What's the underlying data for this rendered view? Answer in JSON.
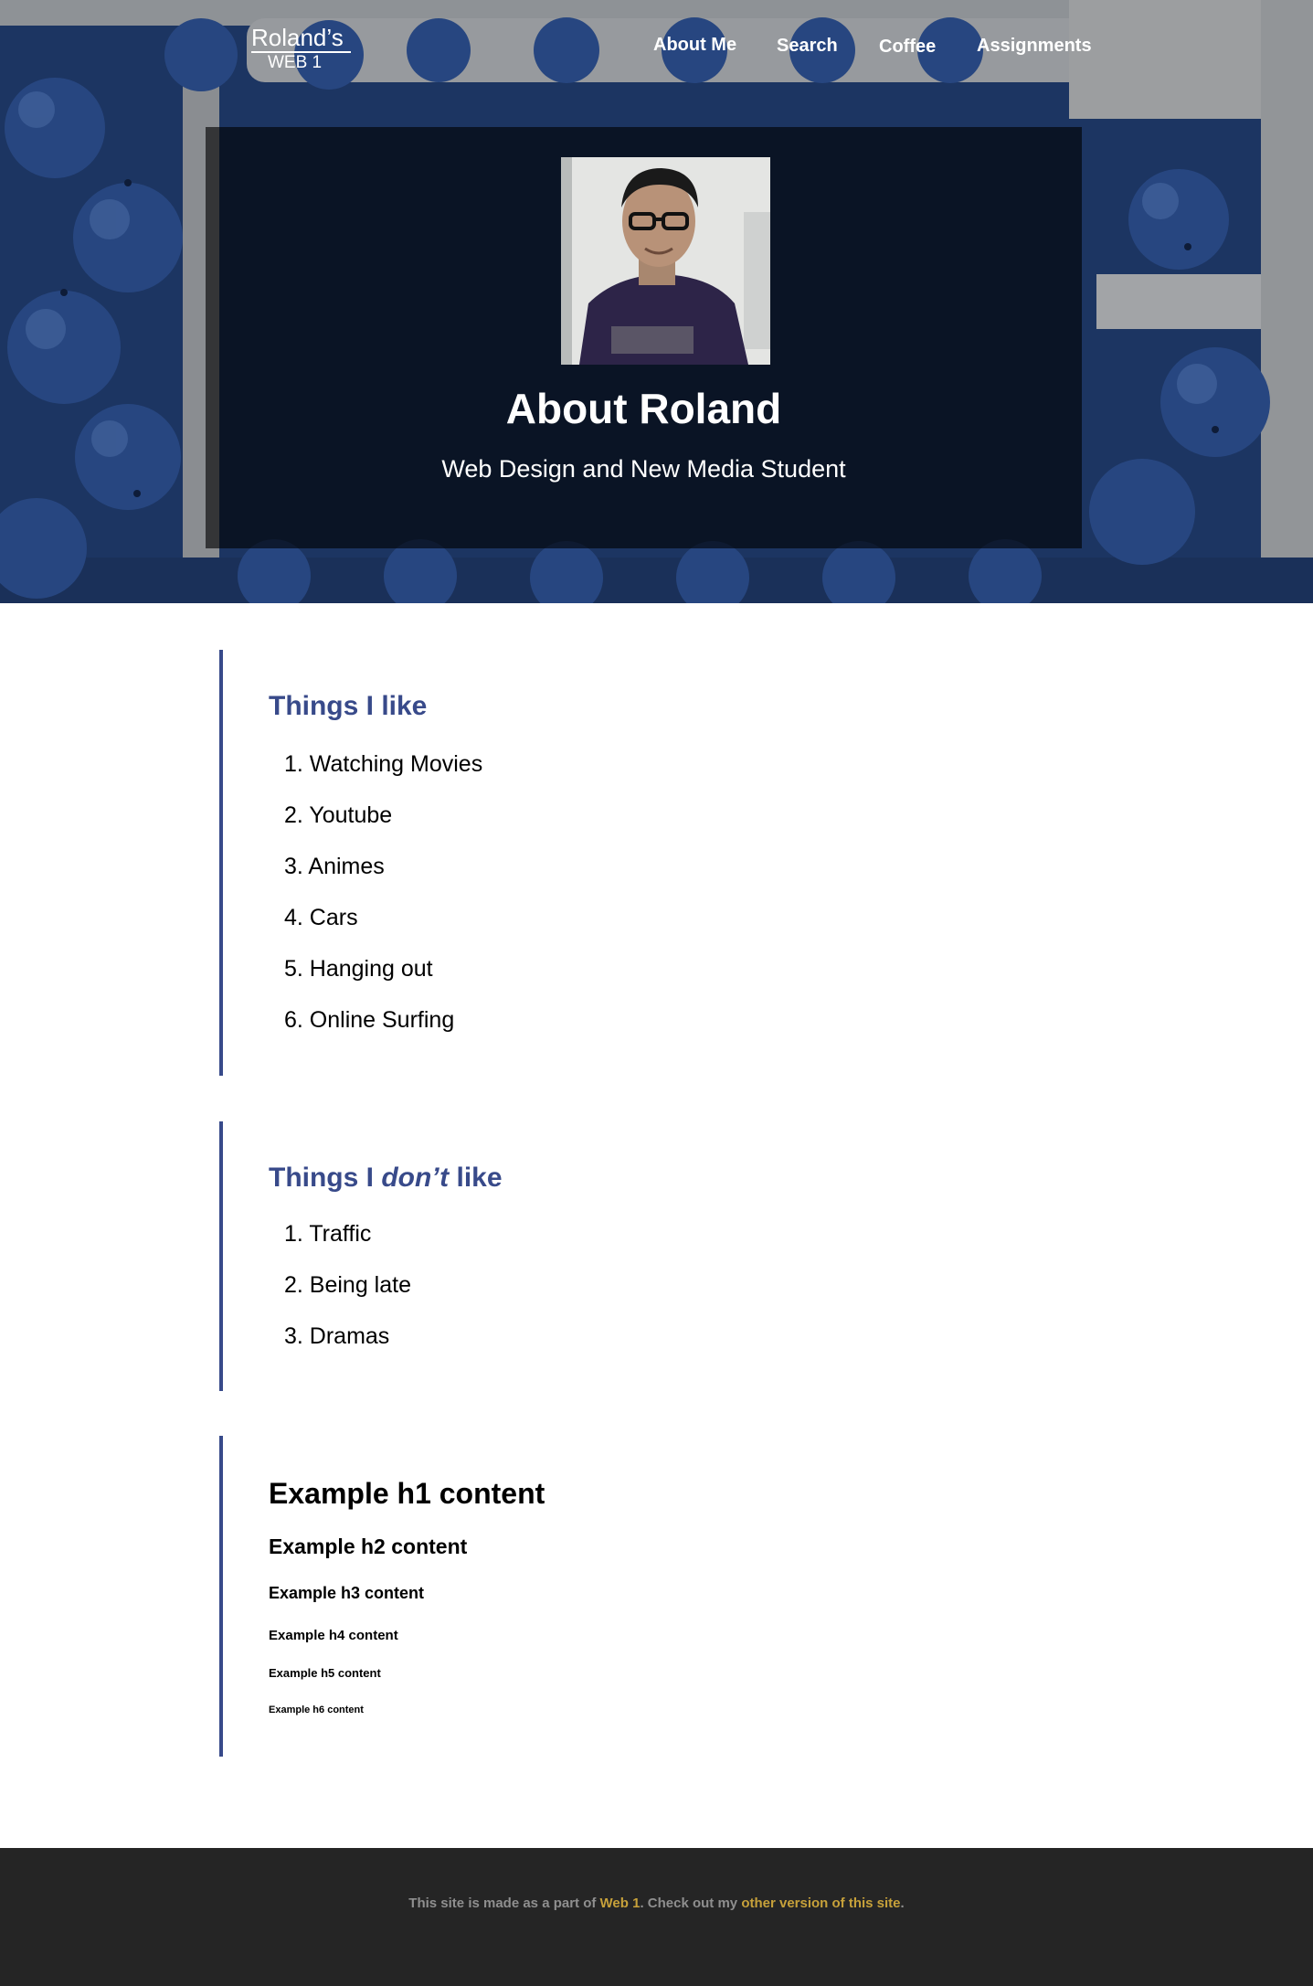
{
  "brand": {
    "name": "Roland’s",
    "sub": "WEB 1"
  },
  "nav": {
    "about": "About Me",
    "search": "Search",
    "coffee": "Coffee",
    "assignments": "Assignments"
  },
  "hero": {
    "title": "About Roland",
    "subtitle": "Web Design and New Media Student"
  },
  "likes": {
    "title": "Things I like",
    "items": [
      "1. Watching Movies",
      "2. Youtube",
      "3. Animes",
      "4. Cars",
      "5. Hanging out",
      "6. Online Surfing"
    ]
  },
  "dislikes": {
    "title_before": "Things I ",
    "title_em": "don’t",
    "title_after": " like",
    "items": [
      "1. Traffic",
      "2. Being late",
      "3. Dramas"
    ]
  },
  "headings": {
    "h1": "Example h1 content",
    "h2": "Example h2 content",
    "h3": "Example h3 content",
    "h4": "Example h4 content",
    "h5": "Example h5 content",
    "h6": "Example h6 content"
  },
  "footer": {
    "text_before": "This site is made as a part of ",
    "link1": "Web 1",
    "text_middle": ". Check out my ",
    "link2": "other version of this site",
    "text_after": "."
  },
  "colors": {
    "accent": "#384a8a",
    "footer_bg": "#252525",
    "footer_link": "#c7a13a",
    "footer_text": "#8f8f8f"
  }
}
